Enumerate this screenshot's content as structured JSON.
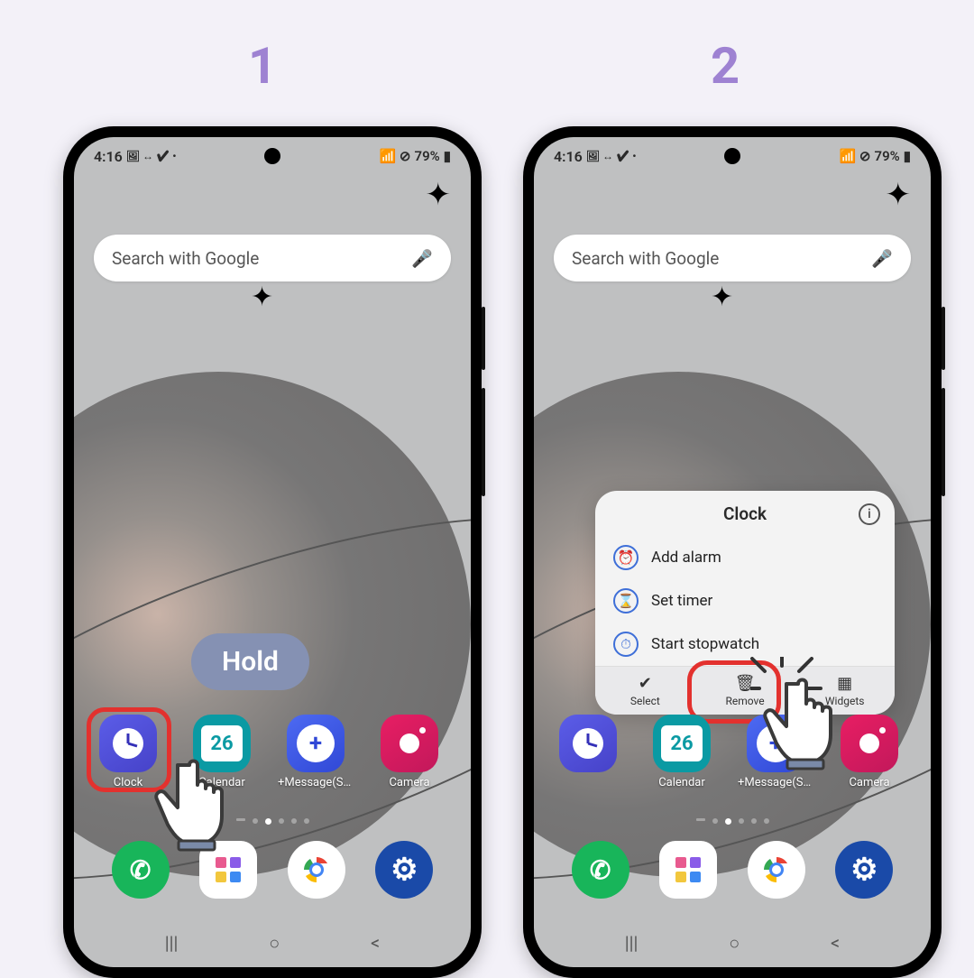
{
  "steps": {
    "one": "1",
    "two": "2"
  },
  "status": {
    "time": "4:16",
    "battery": "79%"
  },
  "search": {
    "placeholder": "Search with Google"
  },
  "hold_label": "Hold",
  "apps_row": [
    {
      "name": "clock",
      "label": "Clock"
    },
    {
      "name": "calendar",
      "label": "Calendar",
      "badge": "26"
    },
    {
      "name": "message",
      "label": "+Message(SM..."
    },
    {
      "name": "camera",
      "label": "Camera"
    }
  ],
  "dock": [
    {
      "name": "phone"
    },
    {
      "name": "apps"
    },
    {
      "name": "chrome"
    },
    {
      "name": "settings"
    }
  ],
  "menu": {
    "title": "Clock",
    "items": [
      {
        "icon": "alarm",
        "label": "Add alarm"
      },
      {
        "icon": "timer",
        "label": "Set timer"
      },
      {
        "icon": "stopwatch",
        "label": "Start stopwatch"
      }
    ],
    "bar": [
      {
        "icon": "select",
        "label": "Select"
      },
      {
        "icon": "remove",
        "label": "Remove"
      },
      {
        "icon": "widgets",
        "label": "Widgets"
      }
    ]
  }
}
